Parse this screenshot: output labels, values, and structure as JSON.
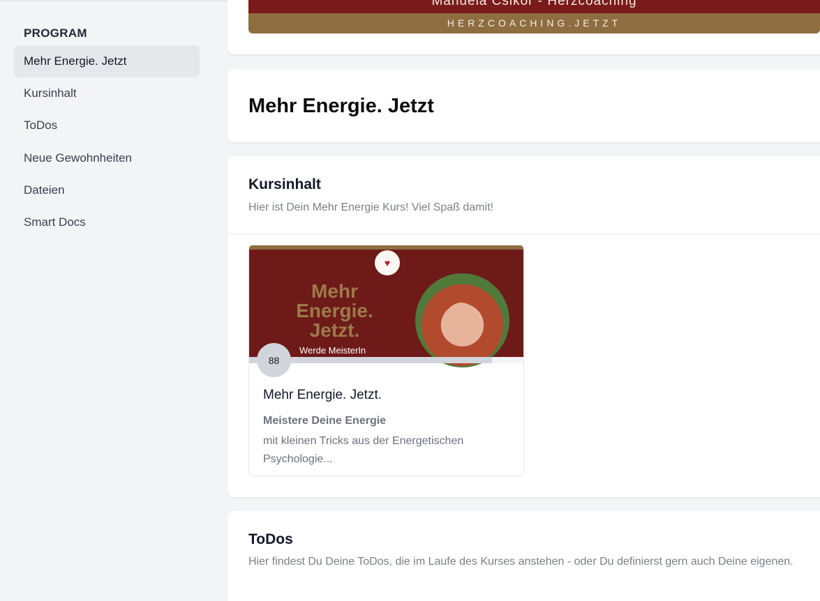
{
  "sidebar": {
    "heading": "PROGRAM",
    "items": [
      {
        "label": "Mehr Energie. Jetzt",
        "active": true
      },
      {
        "label": "Kursinhalt",
        "active": false
      },
      {
        "label": "ToDos",
        "active": false
      },
      {
        "label": "Neue Gewohnheiten",
        "active": false
      },
      {
        "label": "Dateien",
        "active": false
      },
      {
        "label": "Smart Docs",
        "active": false
      }
    ]
  },
  "banner": {
    "name": "Manuela Csikor - Herzcoaching",
    "url": "HERZCOACHING.JETZT"
  },
  "page_title": "Mehr Energie. Jetzt",
  "kursinhalt": {
    "title": "Kursinhalt",
    "subtitle": "Hier ist Dein Mehr Energie Kurs! Viel Spaß damit!",
    "course": {
      "thumbnail_title": "Mehr Energie. Jetzt.",
      "thumbnail_subtitle": "Werde MeisterIn",
      "progress_percent": 88,
      "progress_label": "88",
      "name": "Mehr Energie. Jetzt.",
      "description_strong": "Meistere Deine Energie",
      "description": "mit kleinen Tricks aus der Energetischen Psychologie..."
    }
  },
  "todos": {
    "title": "ToDos",
    "subtitle": "Hier findest Du Deine ToDos, die im Laufe des Kurses anstehen - oder Du definierst gern auch Deine eigenen."
  },
  "colors": {
    "sidebar_active_bg": "#e5e7eb",
    "brand_red": "#6e1a19",
    "brand_gold": "#8e6d40"
  }
}
